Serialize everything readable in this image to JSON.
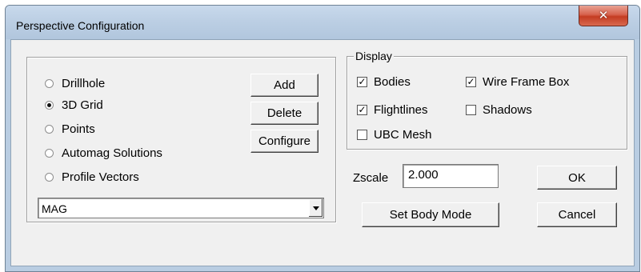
{
  "window": {
    "title": "Perspective Configuration"
  },
  "object_types": {
    "selected": "3D Grid",
    "items": [
      {
        "label": "Drillhole",
        "checked": false
      },
      {
        "label": "3D Grid",
        "checked": true
      },
      {
        "label": "Points",
        "checked": false
      },
      {
        "label": "Automag Solutions",
        "checked": false
      },
      {
        "label": "Profile Vectors",
        "checked": false
      }
    ]
  },
  "object_buttons": {
    "add": "Add",
    "delete": "Delete",
    "configure": "Configure"
  },
  "object_combo": {
    "value": "MAG"
  },
  "display": {
    "label": "Display",
    "options": [
      {
        "label": "Bodies",
        "checked": true
      },
      {
        "label": "Wire Frame Box",
        "checked": true
      },
      {
        "label": "Flightlines",
        "checked": true
      },
      {
        "label": "Shadows",
        "checked": false
      },
      {
        "label": "UBC Mesh",
        "checked": false
      }
    ]
  },
  "zscale": {
    "label": "Zscale",
    "value": "2.000"
  },
  "buttons": {
    "ok": "OK",
    "cancel": "Cancel",
    "set_body_mode": "Set Body Mode"
  }
}
